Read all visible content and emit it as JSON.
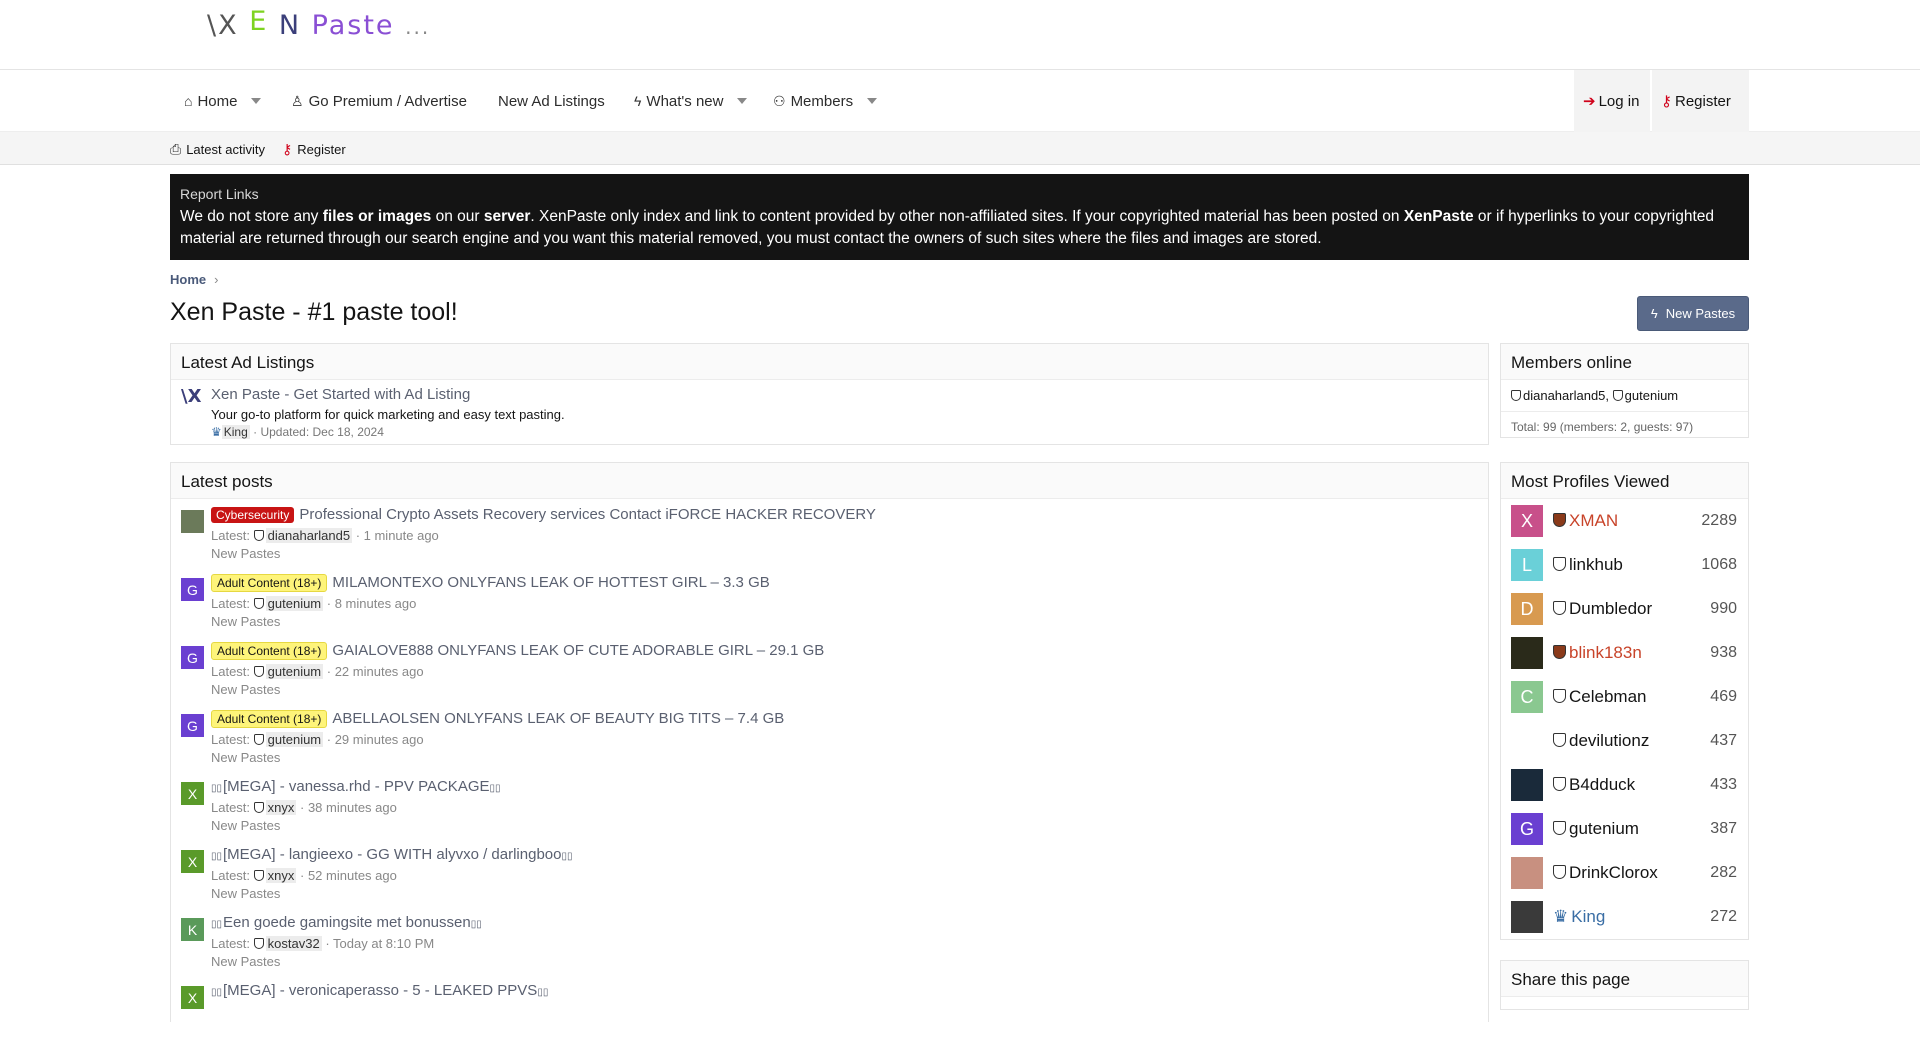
{
  "logo": {
    "p1": "\\X",
    "p2": "E",
    "p3": "N",
    "p4": "Paste",
    "p5": "..."
  },
  "nav": {
    "home": "Home",
    "premium": "Go Premium / Advertise",
    "ads": "New Ad Listings",
    "whatsnew": "What's new",
    "members": "Members",
    "login": "Log in",
    "register": "Register"
  },
  "subnav": {
    "latest": "Latest activity",
    "register": "Register"
  },
  "notice": {
    "title": "Report Links",
    "t1": "We do not store any ",
    "b1": "files or images",
    "t2": " on our ",
    "b2": "server",
    "t3": ". XenPaste only index and link to content provided by other non-affiliated sites. If your copyrighted material has been posted on ",
    "b3": "XenPaste",
    "t4": " or if hyperlinks to your copyrighted material are returned through our search engine and you want this material removed, you must contact the owners of such sites where the files and images are stored."
  },
  "breadcrumb": "Home",
  "page_title": "Xen Paste - #1 paste tool!",
  "new_pastes_btn": "New Pastes",
  "ad_block": {
    "heading": "Latest Ad Listings",
    "logo": "\\X",
    "title": "Xen Paste - Get Started with Ad Listing",
    "desc": "Your go-to platform for quick marketing and easy text pasting.",
    "user": "King",
    "updated": "· Updated: Dec 18, 2024"
  },
  "posts_block": {
    "heading": "Latest posts",
    "posts": [
      {
        "badge": "Cybersecurity",
        "badge_type": "cyber",
        "title": "Professional Crypto Assets Recovery services Contact iFORCE HACKER RECOVERY",
        "latest": "Latest:",
        "user": "dianaharland5",
        "time": "· 1 minute ago",
        "forum": "New Pastes",
        "avatar": "",
        "avatar_color": "#6b7a5a"
      },
      {
        "badge": "Adult Content (18+)",
        "badge_type": "adult",
        "title": "MILAMONTEXO ONLYFANS LEAK OF HOTTEST GIRL – 3.3 GB",
        "latest": "Latest:",
        "user": "gutenium",
        "time": "· 8 minutes ago",
        "forum": "New Pastes",
        "avatar": "G",
        "avatar_color": "#6a3fd1"
      },
      {
        "badge": "Adult Content (18+)",
        "badge_type": "adult",
        "title": "GAIALOVE888 ONLYFANS LEAK OF CUTE ADORABLE GIRL – 29.1 GB",
        "latest": "Latest:",
        "user": "gutenium",
        "time": "· 22 minutes ago",
        "forum": "New Pastes",
        "avatar": "G",
        "avatar_color": "#6a3fd1"
      },
      {
        "badge": "Adult Content (18+)",
        "badge_type": "adult",
        "title": "ABELLAOLSEN ONLYFANS LEAK OF BEAUTY BIG TITS – 7.4 GB",
        "latest": "Latest:",
        "user": "gutenium",
        "time": "· 29 minutes ago",
        "forum": "New Pastes",
        "avatar": "G",
        "avatar_color": "#6a3fd1"
      },
      {
        "badge": "",
        "badge_type": "",
        "title": "[MEGA] - vanessa.rhd - PPV PACKAGE",
        "latest": "Latest:",
        "user": "xnyx",
        "time": "· 38 minutes ago",
        "forum": "New Pastes",
        "avatar": "X",
        "avatar_color": "#5a9a2a"
      },
      {
        "badge": "",
        "badge_type": "",
        "title": "[MEGA] - langieexo - GG WITH alyvxo / darlingboo",
        "latest": "Latest:",
        "user": "xnyx",
        "time": "· 52 minutes ago",
        "forum": "New Pastes",
        "avatar": "X",
        "avatar_color": "#5a9a2a"
      },
      {
        "badge": "",
        "badge_type": "",
        "title": "Een goede gamingsite met bonussen",
        "latest": "Latest:",
        "user": "kostav32",
        "time": "· Today at 8:10 PM",
        "forum": "New Pastes",
        "avatar": "K",
        "avatar_color": "#5a9a5a"
      },
      {
        "badge": "",
        "badge_type": "",
        "title": "[MEGA] - veronicaperasso - 5 - LEAKED PPVS",
        "latest": "",
        "user": "",
        "time": "",
        "forum": "",
        "avatar": "X",
        "avatar_color": "#5a9a2a"
      }
    ]
  },
  "members_online": {
    "heading": "Members online",
    "m1": "dianaharland5",
    "sep": ",",
    "m2": "gutenium",
    "total": "Total: 99 (members: 2, guests: 97)"
  },
  "most_viewed": {
    "heading": "Most Profiles Viewed",
    "profiles": [
      {
        "initial": "X",
        "color": "#c8508a",
        "name": "XMAN",
        "count": "2289",
        "style": "orange"
      },
      {
        "initial": "L",
        "color": "#6ad0d8",
        "name": "linkhub",
        "count": "1068",
        "style": ""
      },
      {
        "initial": "D",
        "color": "#d89a50",
        "name": "Dumbledor",
        "count": "990",
        "style": ""
      },
      {
        "initial": "",
        "color": "#2a2a1a",
        "name": "blink183n",
        "count": "938",
        "style": "orange"
      },
      {
        "initial": "C",
        "color": "#8ac890",
        "name": "Celebman",
        "count": "469",
        "style": ""
      },
      {
        "initial": "",
        "color": "#ffffff",
        "name": "devilutionz",
        "count": "437",
        "style": ""
      },
      {
        "initial": "",
        "color": "#1a2a3a",
        "name": "B4dduck",
        "count": "433",
        "style": ""
      },
      {
        "initial": "G",
        "color": "#6a3fd1",
        "name": "gutenium",
        "count": "387",
        "style": ""
      },
      {
        "initial": "",
        "color": "#c89080",
        "name": "DrinkClorox",
        "count": "282",
        "style": ""
      },
      {
        "initial": "",
        "color": "#3a3a3a",
        "name": "King",
        "count": "272",
        "style": "blue"
      }
    ]
  },
  "share": {
    "heading": "Share this page"
  }
}
